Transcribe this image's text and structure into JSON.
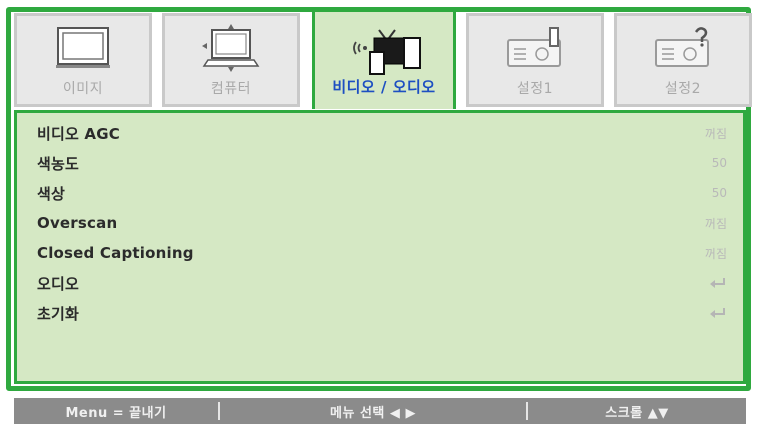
{
  "tabs": [
    {
      "label": "이미지",
      "icon": "monitor-icon",
      "active": false
    },
    {
      "label": "컴퓨터",
      "icon": "computer-icon",
      "active": false
    },
    {
      "label": "비디오 / 오디오",
      "icon": "video-audio-icon",
      "active": true
    },
    {
      "label": "설정1",
      "icon": "projector-settings-icon",
      "active": false
    },
    {
      "label": "설정2",
      "icon": "projector-help-icon",
      "active": false
    }
  ],
  "menu": {
    "items": [
      {
        "name": "비디오 AGC",
        "value": "꺼짐"
      },
      {
        "name": "색농도",
        "value": "50"
      },
      {
        "name": "색상",
        "value": "50"
      },
      {
        "name": "Overscan",
        "value": "꺼짐"
      },
      {
        "name": "Closed Captioning",
        "value": "꺼짐"
      },
      {
        "name": "오디오",
        "value": "",
        "icon": "enter-icon"
      },
      {
        "name": "초기화",
        "value": "",
        "icon": "enter-icon"
      }
    ]
  },
  "status": {
    "menu_hint": "Menu = 끝내기",
    "select_hint": "메뉴 선택 ◀ ▶",
    "scroll_hint": "스크롤 ▲▼"
  },
  "colors": {
    "accent": "#2fa93f",
    "panel_bg": "#d5e8c4",
    "active_label": "#1d4fc2",
    "statusbar": "#8b8b8b"
  }
}
